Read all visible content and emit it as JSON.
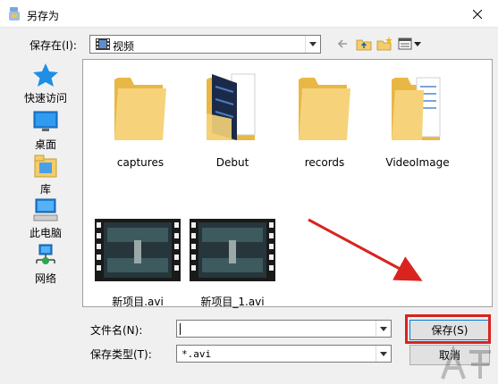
{
  "window": {
    "title": "另存为"
  },
  "lookin": {
    "label": "保存在(I):",
    "value": "视频"
  },
  "sidebar": {
    "items": [
      {
        "label": "快速访问",
        "icon": "star-icon"
      },
      {
        "label": "桌面",
        "icon": "desktop-icon"
      },
      {
        "label": "库",
        "icon": "library-icon"
      },
      {
        "label": "此电脑",
        "icon": "computer-icon"
      },
      {
        "label": "网络",
        "icon": "network-icon"
      }
    ]
  },
  "files": [
    {
      "name": "captures",
      "type": "folder"
    },
    {
      "name": "Debut",
      "type": "folder"
    },
    {
      "name": "records",
      "type": "folder"
    },
    {
      "name": "VideoImage",
      "type": "folder"
    },
    {
      "name": "新项目.avi",
      "type": "video"
    },
    {
      "name": "新项目_1.avi",
      "type": "video"
    }
  ],
  "filename": {
    "label": "文件名(N):",
    "value": ""
  },
  "filetype": {
    "label": "保存类型(T):",
    "value": "*.avi"
  },
  "buttons": {
    "save": "保存(S)",
    "cancel": "取消"
  },
  "colors": {
    "highlight": "#d9231f",
    "folder": "#f3cd6b",
    "accent": "#0078d7"
  }
}
